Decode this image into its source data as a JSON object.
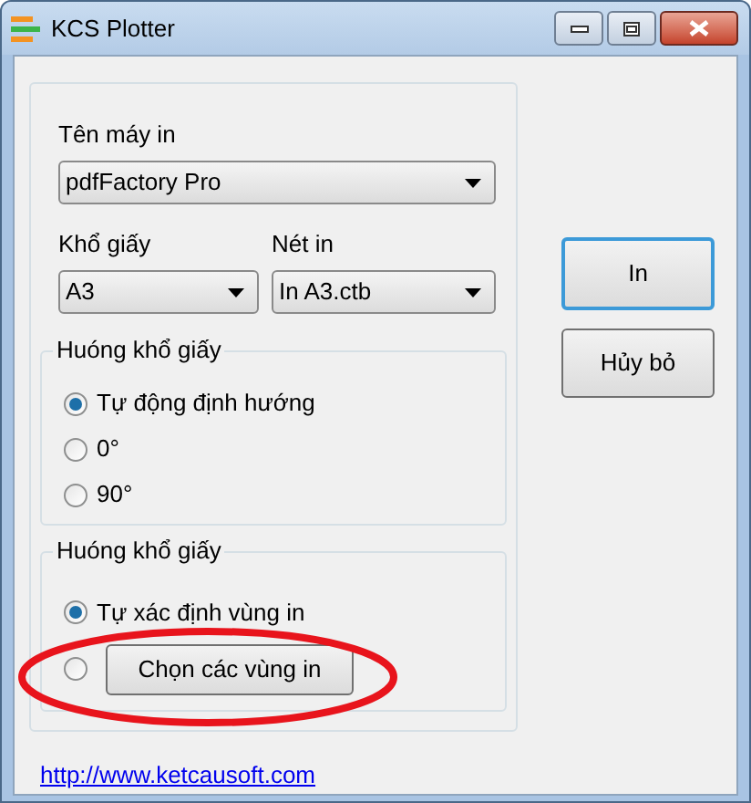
{
  "window": {
    "title": "KCS Plotter"
  },
  "printer": {
    "label": "Tên máy in",
    "value": "pdfFactory Pro"
  },
  "paper_size": {
    "label": "Khổ giấy",
    "value": "A3"
  },
  "pen": {
    "label": "Nét in",
    "value": "In A3.ctb"
  },
  "orientation_group": {
    "title": "Huóng khổ giấy",
    "options": [
      {
        "label": "Tự động định hướng",
        "selected": true
      },
      {
        "label": "0°",
        "selected": false
      },
      {
        "label": "90°",
        "selected": false
      }
    ]
  },
  "area_group": {
    "title": "Huóng khổ giấy",
    "options": [
      {
        "kind": "label",
        "label": "Tự xác định vùng in",
        "selected": true
      },
      {
        "kind": "button",
        "label": "Chọn các vùng in",
        "selected": false
      }
    ]
  },
  "buttons": [
    {
      "label": "In",
      "focused": true
    },
    {
      "label": "Hủy bỏ",
      "focused": false
    }
  ],
  "link": "http://www.ketcausoft.com"
}
